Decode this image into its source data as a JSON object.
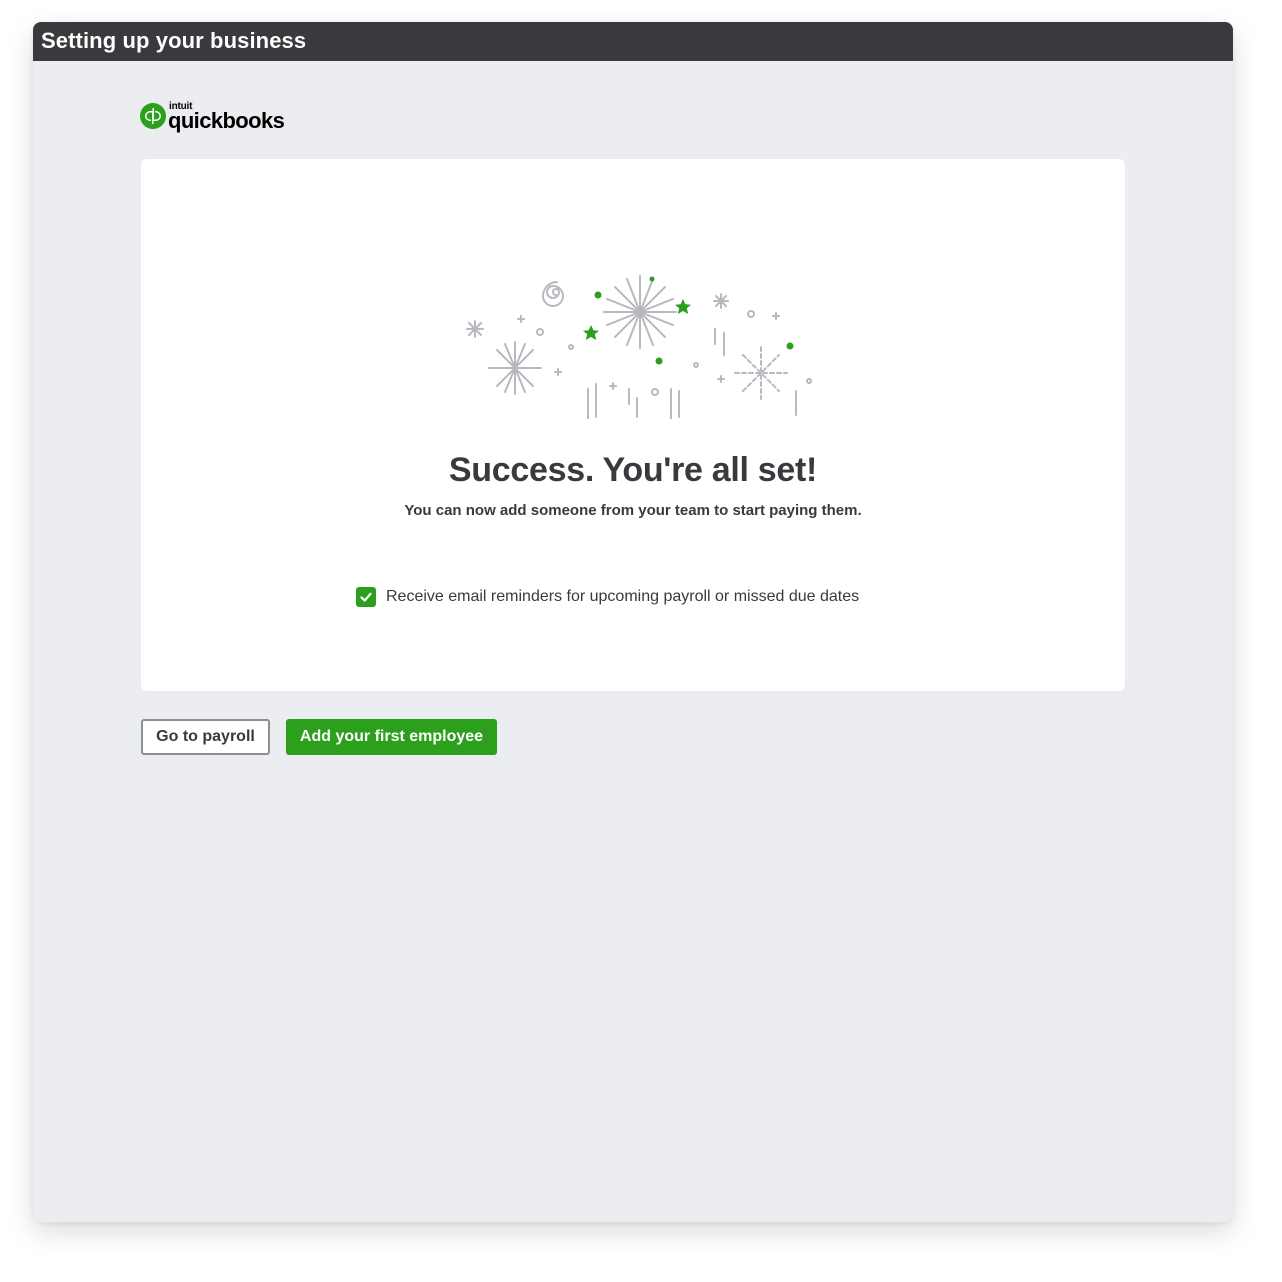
{
  "window": {
    "title": "Setting up your business"
  },
  "logo": {
    "brand_small": "intuit",
    "brand_main": "quickbooks",
    "accent": "#2ca01c"
  },
  "success": {
    "illustration_icon": "fireworks-celebration",
    "headline": "Success. You're all set!",
    "subline": "You can now add someone from your team to start paying them."
  },
  "reminder": {
    "checked": true,
    "label": "Receive email reminders for upcoming payroll or missed due dates"
  },
  "actions": {
    "secondary_label": "Go to payroll",
    "primary_label": "Add your first employee"
  },
  "colors": {
    "titlebar": "#393a3d",
    "page_background": "#ecedf1",
    "primary_green": "#2ca01c",
    "text_dark": "#393a3d"
  }
}
